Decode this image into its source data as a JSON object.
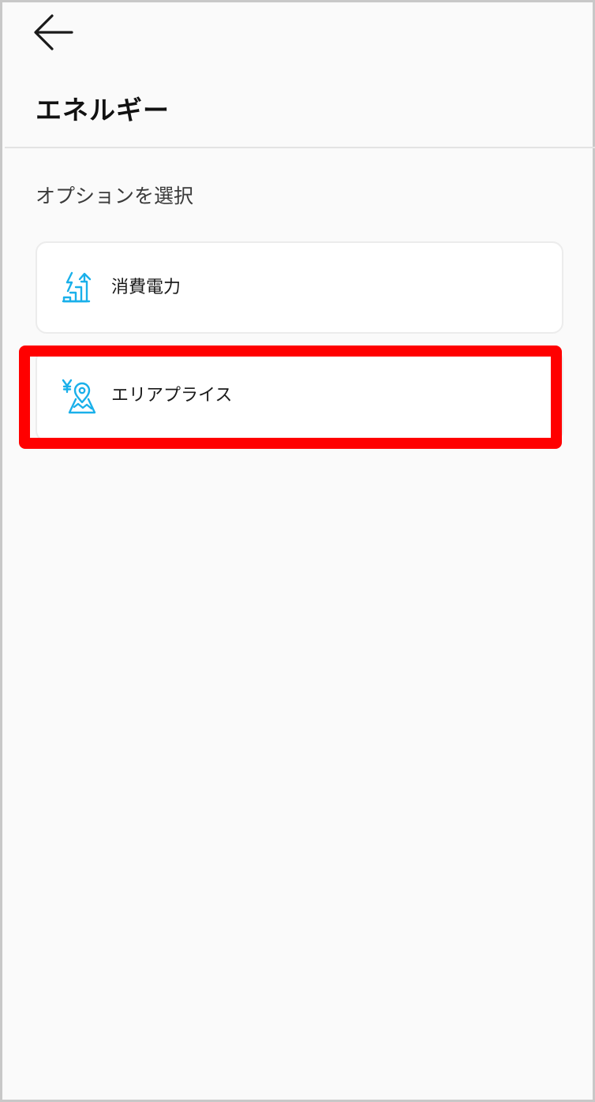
{
  "header": {
    "back_icon": "arrow-left-icon",
    "title": "エネルギー"
  },
  "main": {
    "section_label": "オプションを選択",
    "options": [
      {
        "label": "消費電力",
        "icon": "power-consumption-chart-icon"
      },
      {
        "label": "エリアプライス",
        "icon": "yen-location-map-icon"
      }
    ]
  },
  "colors": {
    "accent": "#1ab0ea",
    "highlight": "#ff0000",
    "background": "#fafafa",
    "card_border": "#ececec"
  }
}
